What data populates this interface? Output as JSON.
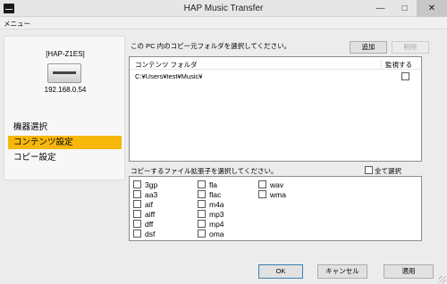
{
  "window": {
    "title": "HAP Music Transfer",
    "minimize": "—",
    "maximize": "□",
    "close": "✕"
  },
  "menu": {
    "label": "メニュー"
  },
  "device": {
    "name": "[HAP-Z1ES]",
    "ip": "192.168.0.54"
  },
  "nav": {
    "items": [
      {
        "label": "機器選択"
      },
      {
        "label": "コンテンツ設定",
        "active": true
      },
      {
        "label": "コピー設定"
      }
    ]
  },
  "content": {
    "folder_instruction": "この PC 内のコピー元フォルダを選択してください。",
    "add_button": "追加",
    "delete_button": "削除",
    "columns": {
      "folder": "コンテンツ フォルダ",
      "monitor": "監視する"
    },
    "folders": [
      {
        "path": "C:¥Users¥test¥Music¥",
        "monitor": false
      }
    ],
    "extension_instruction": "コピーするファイル拡張子を選択してください。",
    "select_all": "全て選択",
    "extensions": [
      {
        "label": "3gp"
      },
      {
        "label": "aa3"
      },
      {
        "label": "aif"
      },
      {
        "label": "aiff"
      },
      {
        "label": "dff"
      },
      {
        "label": "dsf"
      },
      {
        "label": "fla"
      },
      {
        "label": "flac"
      },
      {
        "label": "m4a"
      },
      {
        "label": "mp3"
      },
      {
        "label": "mp4"
      },
      {
        "label": "oma"
      },
      {
        "label": "wav"
      },
      {
        "label": "wma"
      }
    ]
  },
  "footer": {
    "ok": "OK",
    "cancel": "キャンセル",
    "apply": "適用"
  },
  "colors": {
    "accent": "#f6b60a"
  }
}
